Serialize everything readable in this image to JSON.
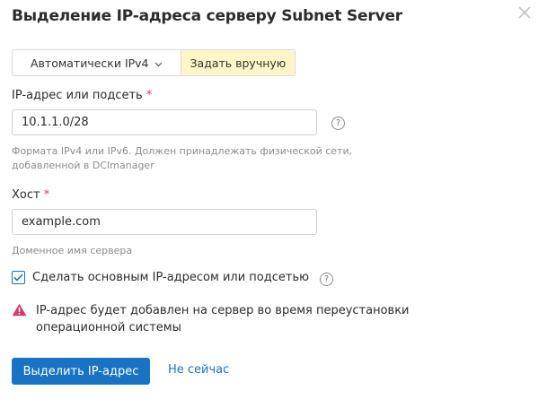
{
  "dialog": {
    "title": "Выделение IP-адреса серверу Subnet Server"
  },
  "mode_switch": {
    "auto_label": "Автоматически IPv4",
    "manual_label": "Задать вручную",
    "selected": "manual"
  },
  "ip_field": {
    "label": "IP-адрес или подсеть",
    "required_mark": "*",
    "value": "10.1.1.0/28",
    "help_icon": "?",
    "hint_line1": "Формата IPv4 или IPv6. Должен принадлежать физической сети,",
    "hint_line2": "добавленной в DCImanager"
  },
  "host_field": {
    "label": "Хост",
    "required_mark": "*",
    "value": "example.com",
    "hint": "Доменное имя сервера"
  },
  "primary_checkbox": {
    "label": "Сделать основным IP-адресом или подсетью",
    "checked": true,
    "help_icon": "?"
  },
  "warning": {
    "text": "IP-адрес будет добавлен на сервер во время переустановки операционной системы",
    "color": "#d6376b"
  },
  "actions": {
    "submit_label": "Выделить IP-адрес",
    "cancel_label": "Не сейчас"
  },
  "colors": {
    "accent": "#1973c4",
    "active_segment": "#fef6c9",
    "required": "#d6376b"
  }
}
